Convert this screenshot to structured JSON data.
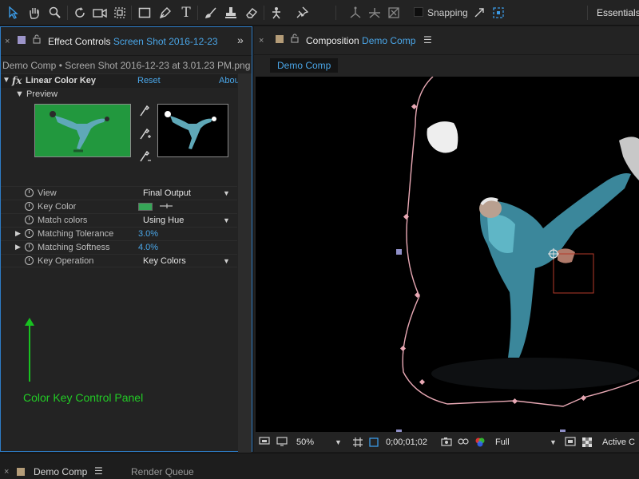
{
  "toolbar": {
    "snapping_label": "Snapping",
    "workspace_label": "Essentials",
    "icons": [
      "selection-tool-icon",
      "hand-tool-icon",
      "zoom-tool-icon",
      "rotate-tool-icon",
      "camera-tool-icon",
      "pan-behind-tool-icon",
      "rectangle-tool-icon",
      "pen-tool-icon",
      "type-tool-icon",
      "brush-tool-icon",
      "clone-stamp-tool-icon",
      "eraser-tool-icon",
      "roto-brush-tool-icon",
      "puppet-pin-tool-icon"
    ]
  },
  "effect_controls": {
    "close_glyph": "×",
    "tab_label": "Effect Controls",
    "tab_layer": "Screen Shot 2016-12-23",
    "breadcrumb": "Demo Comp • Screen Shot 2016-12-23 at 3.01.23 PM.png",
    "effect": {
      "name": "Linear Color Key",
      "reset_label": "Reset",
      "about_label": "Abou",
      "preview_label": "Preview"
    },
    "properties": [
      {
        "label": "View",
        "value": "Final Output",
        "type": "dropdown"
      },
      {
        "label": "Key Color",
        "value": "",
        "type": "color",
        "color": "#36a657"
      },
      {
        "label": "Match colors",
        "value": "Using Hue",
        "type": "dropdown"
      },
      {
        "label": "Matching Tolerance",
        "value": "3.0%",
        "type": "number"
      },
      {
        "label": "Matching Softness",
        "value": "4.0%",
        "type": "number"
      },
      {
        "label": "Key Operation",
        "value": "Key Colors",
        "type": "dropdown"
      }
    ],
    "annotation": "Color Key Control Panel"
  },
  "composition": {
    "close_glyph": "×",
    "tab_label": "Composition",
    "tab_comp": "Demo Comp",
    "breadcrumb": "Demo Comp",
    "zoom": "50%",
    "timecode": "0;00;01;02",
    "resolution": "Full",
    "active_camera": "Active C"
  },
  "bottom_tabs": {
    "close_glyph": "×",
    "timeline_label": "Demo Comp",
    "render_queue_label": "Render Queue"
  },
  "colors": {
    "accent_blue": "#4aa6e8",
    "panel_border": "#2d7bc4",
    "annotation_green": "#22cc25",
    "key_color": "#36a657"
  }
}
